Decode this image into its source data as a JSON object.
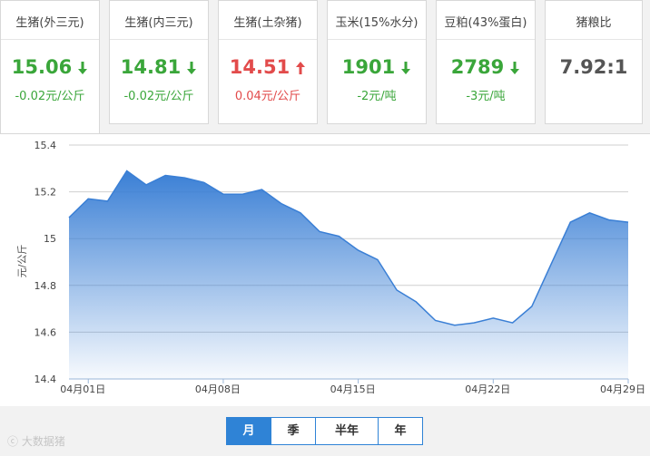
{
  "cards": [
    {
      "title": "生猪(外三元)",
      "price": "15.06",
      "change": "-0.02元/公斤",
      "trend": "down"
    },
    {
      "title": "生猪(内三元)",
      "price": "14.81",
      "change": "-0.02元/公斤",
      "trend": "down"
    },
    {
      "title": "生猪(土杂猪)",
      "price": "14.51",
      "change": "0.04元/公斤",
      "trend": "up"
    },
    {
      "title": "玉米(15%水分)",
      "price": "1901",
      "change": "-2元/吨",
      "trend": "down"
    },
    {
      "title": "豆粕(43%蛋白)",
      "price": "2789",
      "change": "-3元/吨",
      "trend": "down"
    },
    {
      "title": "猪粮比",
      "price": "7.92:1",
      "change": "",
      "trend": "none"
    }
  ],
  "colors": {
    "up": "#e24b4b",
    "down": "#3aa63a",
    "neutral": "#555555",
    "line": "#3a7fd5"
  },
  "chart_data": {
    "type": "area",
    "ylabel": "元/公斤",
    "ylim": [
      14.4,
      15.4
    ],
    "yticks": [
      14.4,
      14.6,
      14.8,
      15,
      15.2,
      15.4
    ],
    "ytick_labels": [
      "14.4",
      "14.6",
      "14.8",
      "15",
      "15.2",
      "15.4"
    ],
    "xlim": [
      0,
      29
    ],
    "xticks": [
      1,
      8,
      15,
      22,
      29
    ],
    "xtick_labels": [
      "04月01日",
      "04月08日",
      "04月15日",
      "04月22日",
      "04月29日"
    ],
    "x": [
      0,
      1,
      2,
      3,
      4,
      5,
      6,
      7,
      8,
      9,
      10,
      11,
      12,
      13,
      14,
      15,
      16,
      17,
      18,
      19,
      20,
      21,
      22,
      23,
      24,
      25,
      26,
      27,
      28,
      29
    ],
    "values": [
      15.09,
      15.17,
      15.16,
      15.29,
      15.23,
      15.27,
      15.26,
      15.24,
      15.19,
      15.19,
      15.21,
      15.15,
      15.11,
      15.03,
      15.01,
      14.95,
      14.91,
      14.78,
      14.73,
      14.65,
      14.63,
      14.64,
      14.66,
      14.64,
      14.71,
      14.89,
      15.07,
      15.11,
      15.08,
      15.07
    ],
    "grid": true
  },
  "tabs": [
    {
      "label": "月",
      "active": true
    },
    {
      "label": "季",
      "active": false
    },
    {
      "label": "半年",
      "active": false
    },
    {
      "label": "年",
      "active": false
    }
  ],
  "watermark": "大数据猪"
}
